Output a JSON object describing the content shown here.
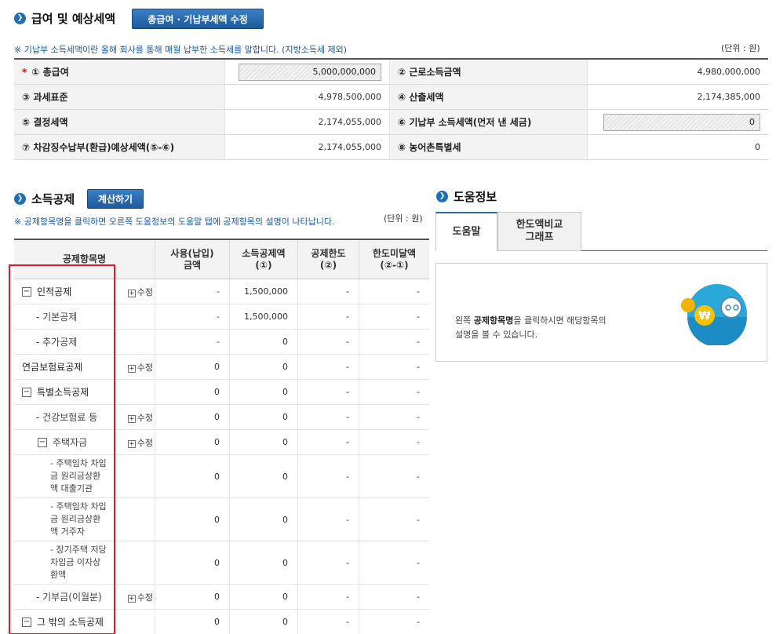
{
  "salary": {
    "title": "급여 및 예상세액",
    "edit_button": "총급여 · 기납부세액 수정",
    "note": "※ 기납부 소득세액이란 올해 회사를 통해 매월 납부한 소득세를 말합니다. (지방소득세 제외)",
    "unit": "(단위 : 원)",
    "rows": [
      {
        "label1": "① 총급여",
        "value1": "5,000,000,000",
        "label2": "② 근로소득금액",
        "value2": "4,980,000,000"
      },
      {
        "label1": "③ 과세표준",
        "value1": "4,978,500,000",
        "label2": "④ 산출세액",
        "value2": "2,174,385,000"
      },
      {
        "label1": "⑤ 결정세액",
        "value1": "2,174,055,000",
        "label2": "⑥ 기납부 소득세액(먼저 낸 세금)",
        "value2": "0"
      },
      {
        "label1": "⑦ 차감징수납부(환급)예상세액(⑤-⑥)",
        "value1": "2,174,055,000",
        "label2": "⑧ 농어촌특별세",
        "value2": "0"
      }
    ],
    "required_mark": "*"
  },
  "deduction": {
    "title": "소득공제",
    "calc_button": "계산하기",
    "note": "※ 공제항목명을 클릭하면 오른쪽 도움정보의 도움말 탭에 공제항목의 설명이 나타납니다.",
    "unit": "(단위 : 원)",
    "headers": {
      "name": "공제항목명",
      "used": [
        "사용(납입)",
        "금액"
      ],
      "amount": [
        "소득공제액",
        "(①)"
      ],
      "limit": [
        "공제한도",
        "(②)"
      ],
      "under": [
        "한도미달액",
        "(②-①)"
      ]
    },
    "edit_label": "수정",
    "rows": [
      {
        "name": "인적공제",
        "used": "-",
        "amount": "1,500,000",
        "limit": "-",
        "under": "-"
      },
      {
        "name": "- 기본공제",
        "used": "-",
        "amount": "1,500,000",
        "limit": "-",
        "under": "-"
      },
      {
        "name": "- 추가공제",
        "used": "-",
        "amount": "0",
        "limit": "-",
        "under": "-"
      },
      {
        "name": "연금보험료공제",
        "used": "0",
        "amount": "0",
        "limit": "-",
        "under": "-"
      },
      {
        "name": "특별소득공제",
        "used": "0",
        "amount": "0",
        "limit": "-",
        "under": "-"
      },
      {
        "name": "- 건강보험료 등",
        "used": "0",
        "amount": "0",
        "limit": "-",
        "under": "-"
      },
      {
        "name": "주택자금",
        "used": "0",
        "amount": "0",
        "limit": "-",
        "under": "-"
      },
      {
        "name_lines": [
          "- 주택임차 차입",
          "금 원리금상환",
          "액 대출기관"
        ],
        "used": "0",
        "amount": "0",
        "limit": "-",
        "under": "-"
      },
      {
        "name_lines": [
          "- 주택임차 차입",
          "금 원리금상환",
          "액 거주자"
        ],
        "used": "0",
        "amount": "0",
        "limit": "-",
        "under": "-"
      },
      {
        "name_lines": [
          "- 장기주택 저당",
          "차입금 이자상",
          "환액"
        ],
        "used": "0",
        "amount": "0",
        "limit": "-",
        "under": "-"
      },
      {
        "name": "- 기부금(이월분)",
        "used": "0",
        "amount": "0",
        "limit": "-",
        "under": "-"
      },
      {
        "name": "그 밖의 소득공제",
        "used": "0",
        "amount": "0",
        "limit": "-",
        "under": "-"
      }
    ]
  },
  "help": {
    "title": "도움정보",
    "tab_help": "도움말",
    "tab_graph_lines": [
      "한도액비교",
      "그래프"
    ],
    "text_prefix": "왼쪽 ",
    "text_bold": "공제항목명",
    "text_suffix": "을 클릭하시면 해당항목의",
    "text_line2": "설명을 볼 수 있습니다.",
    "logo_symbol": "₩"
  }
}
